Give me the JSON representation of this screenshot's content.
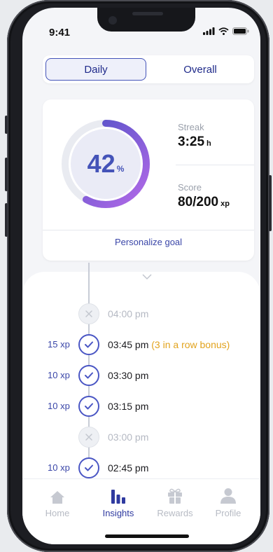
{
  "status": {
    "time": "9:41"
  },
  "tabs": {
    "daily": "Daily",
    "overall": "Overall"
  },
  "progress": {
    "percent": 42,
    "percent_label": "42",
    "percent_symbol": "%"
  },
  "stats": {
    "streak_label": "Streak",
    "streak_value": "3:25",
    "streak_unit": "h",
    "score_label": "Score",
    "score_value": "80/200",
    "score_unit": "xp"
  },
  "goal_link": "Personalize goal",
  "timeline": [
    {
      "xp": "",
      "time": "04:00 pm",
      "note": "",
      "status": "missed"
    },
    {
      "xp": "15 xp",
      "time": "03:45 pm",
      "note": "(3 in a row bonus)",
      "status": "done"
    },
    {
      "xp": "10 xp",
      "time": "03:30 pm",
      "note": "",
      "status": "done"
    },
    {
      "xp": "10 xp",
      "time": "03:15 pm",
      "note": "",
      "status": "done"
    },
    {
      "xp": "",
      "time": "03:00 pm",
      "note": "",
      "status": "missed"
    },
    {
      "xp": "10 xp",
      "time": "02:45 pm",
      "note": "",
      "status": "done"
    }
  ],
  "nav": [
    {
      "label": "Home",
      "icon": "home-icon",
      "active": false
    },
    {
      "label": "Insights",
      "icon": "insights-icon",
      "active": true
    },
    {
      "label": "Rewards",
      "icon": "gift-icon",
      "active": false
    },
    {
      "label": "Profile",
      "icon": "profile-icon",
      "active": false
    }
  ],
  "colors": {
    "accent": "#4453b8",
    "ring_start": "#4a4fc4",
    "ring_end": "#b36ae8",
    "bonus": "#e2a31d"
  }
}
